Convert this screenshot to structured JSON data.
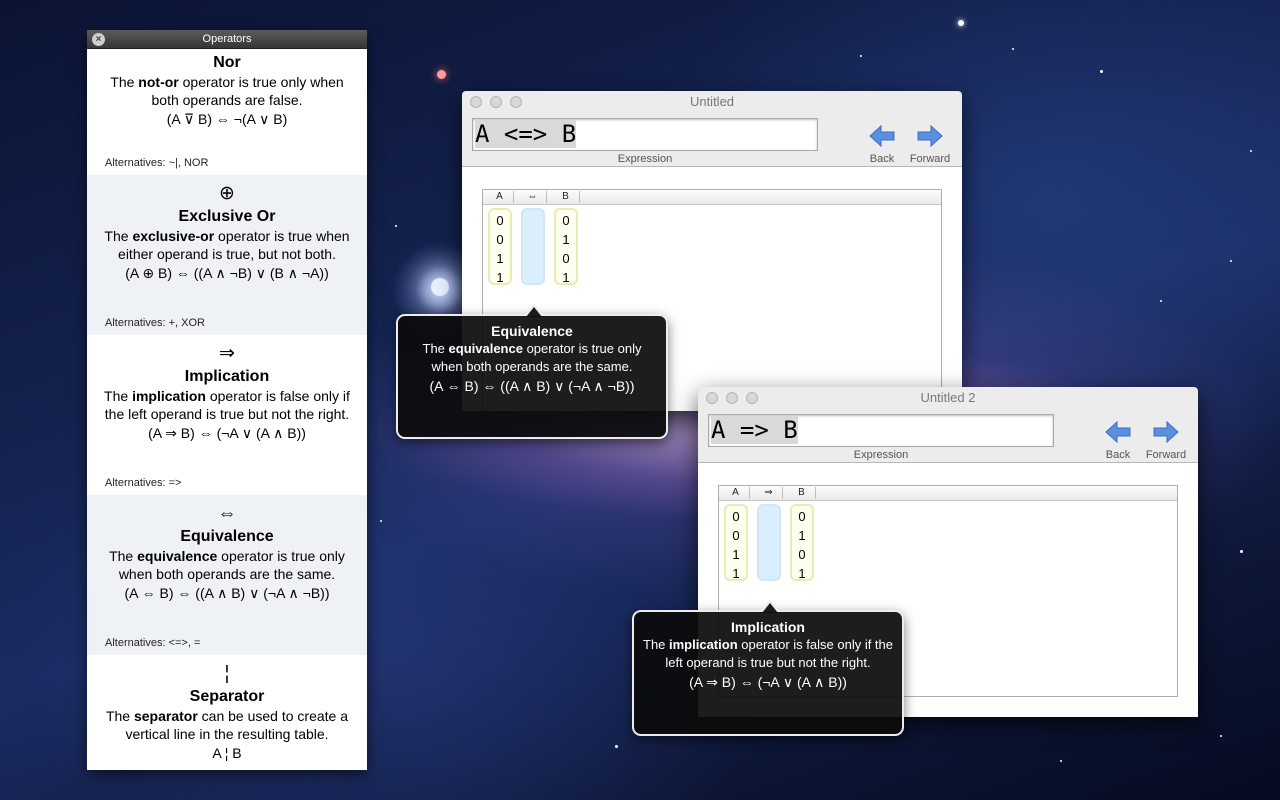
{
  "operators_panel": {
    "title": "Operators",
    "sections": [
      {
        "symbol": "",
        "name": "Nor",
        "desc_pre": "The ",
        "desc_bold": "not-or",
        "desc_post": " operator is true only when both operands are false.",
        "formula": "(A ⊽ B) ⇔ ¬(A ∨ B)",
        "alternatives": "Alternatives:  ~|, NOR"
      },
      {
        "symbol": "⊕",
        "name": "Exclusive Or",
        "desc_pre": "The ",
        "desc_bold": "exclusive-or",
        "desc_post": " operator is true when either operand is true, but not both.",
        "formula": "(A ⊕ B) ⇔ ((A ∧ ¬B) ∨ (B ∧ ¬A))",
        "alternatives": "Alternatives:  +, XOR"
      },
      {
        "symbol": "⇒",
        "name": "Implication",
        "desc_pre": "The ",
        "desc_bold": "implication",
        "desc_post": " operator is false only if the left operand is true but not the right.",
        "formula": "(A ⇒ B) ⇔ (¬A ∨ (A ∧ B))",
        "alternatives": "Alternatives:  =>"
      },
      {
        "symbol": "⇔",
        "name": "Equivalence",
        "desc_pre": "The ",
        "desc_bold": "equivalence",
        "desc_post": " operator is true only when both operands are the same.",
        "formula": "(A ⇔ B) ⇔ ((A ∧ B) ∨ (¬A ∧ ¬B))",
        "alternatives": "Alternatives:  <=>, ="
      },
      {
        "symbol": "¦",
        "name": "Separator",
        "desc_pre": "The ",
        "desc_bold": "separator",
        "desc_post": " can be used to create a vertical line in the resulting table.",
        "formula": "A ¦ B",
        "alternatives": ""
      }
    ]
  },
  "window1": {
    "title": "Untitled",
    "expression": "A <=> B",
    "expression_label": "Expression",
    "back_label": "Back",
    "forward_label": "Forward",
    "headers": [
      "A",
      "⇔",
      "B"
    ],
    "col_a": "0\n0\n1\n1",
    "col_b": "0\n1\n0\n1",
    "tooltip": {
      "name": "Equivalence",
      "desc_pre": "The ",
      "desc_bold": "equivalence",
      "desc_post": " operator is true only when both operands are the same.",
      "formula": "(A ⇔ B) ⇔ ((A ∧ B) ∨ (¬A ∧ ¬B))"
    }
  },
  "window2": {
    "title": "Untitled 2",
    "expression": "A => B",
    "expression_label": "Expression",
    "back_label": "Back",
    "forward_label": "Forward",
    "headers": [
      "A",
      "⇒",
      "B"
    ],
    "col_a": "0\n0\n1\n1",
    "col_b": "0\n1\n0\n1",
    "tooltip": {
      "name": "Implication",
      "desc_pre": "The ",
      "desc_bold": "implication",
      "desc_post": " operator is false only if the left operand is true but not the right.",
      "formula": "(A ⇒ B) ⇔ (¬A ∨ (A ∧ B))"
    }
  },
  "colors": {
    "nav_arrow": "#5b8fe0",
    "result_column": "#dbeefe",
    "value_column_border": "#e7ebb4"
  },
  "icons": [
    "close-icon",
    "back-arrow-icon",
    "forward-arrow-icon"
  ]
}
